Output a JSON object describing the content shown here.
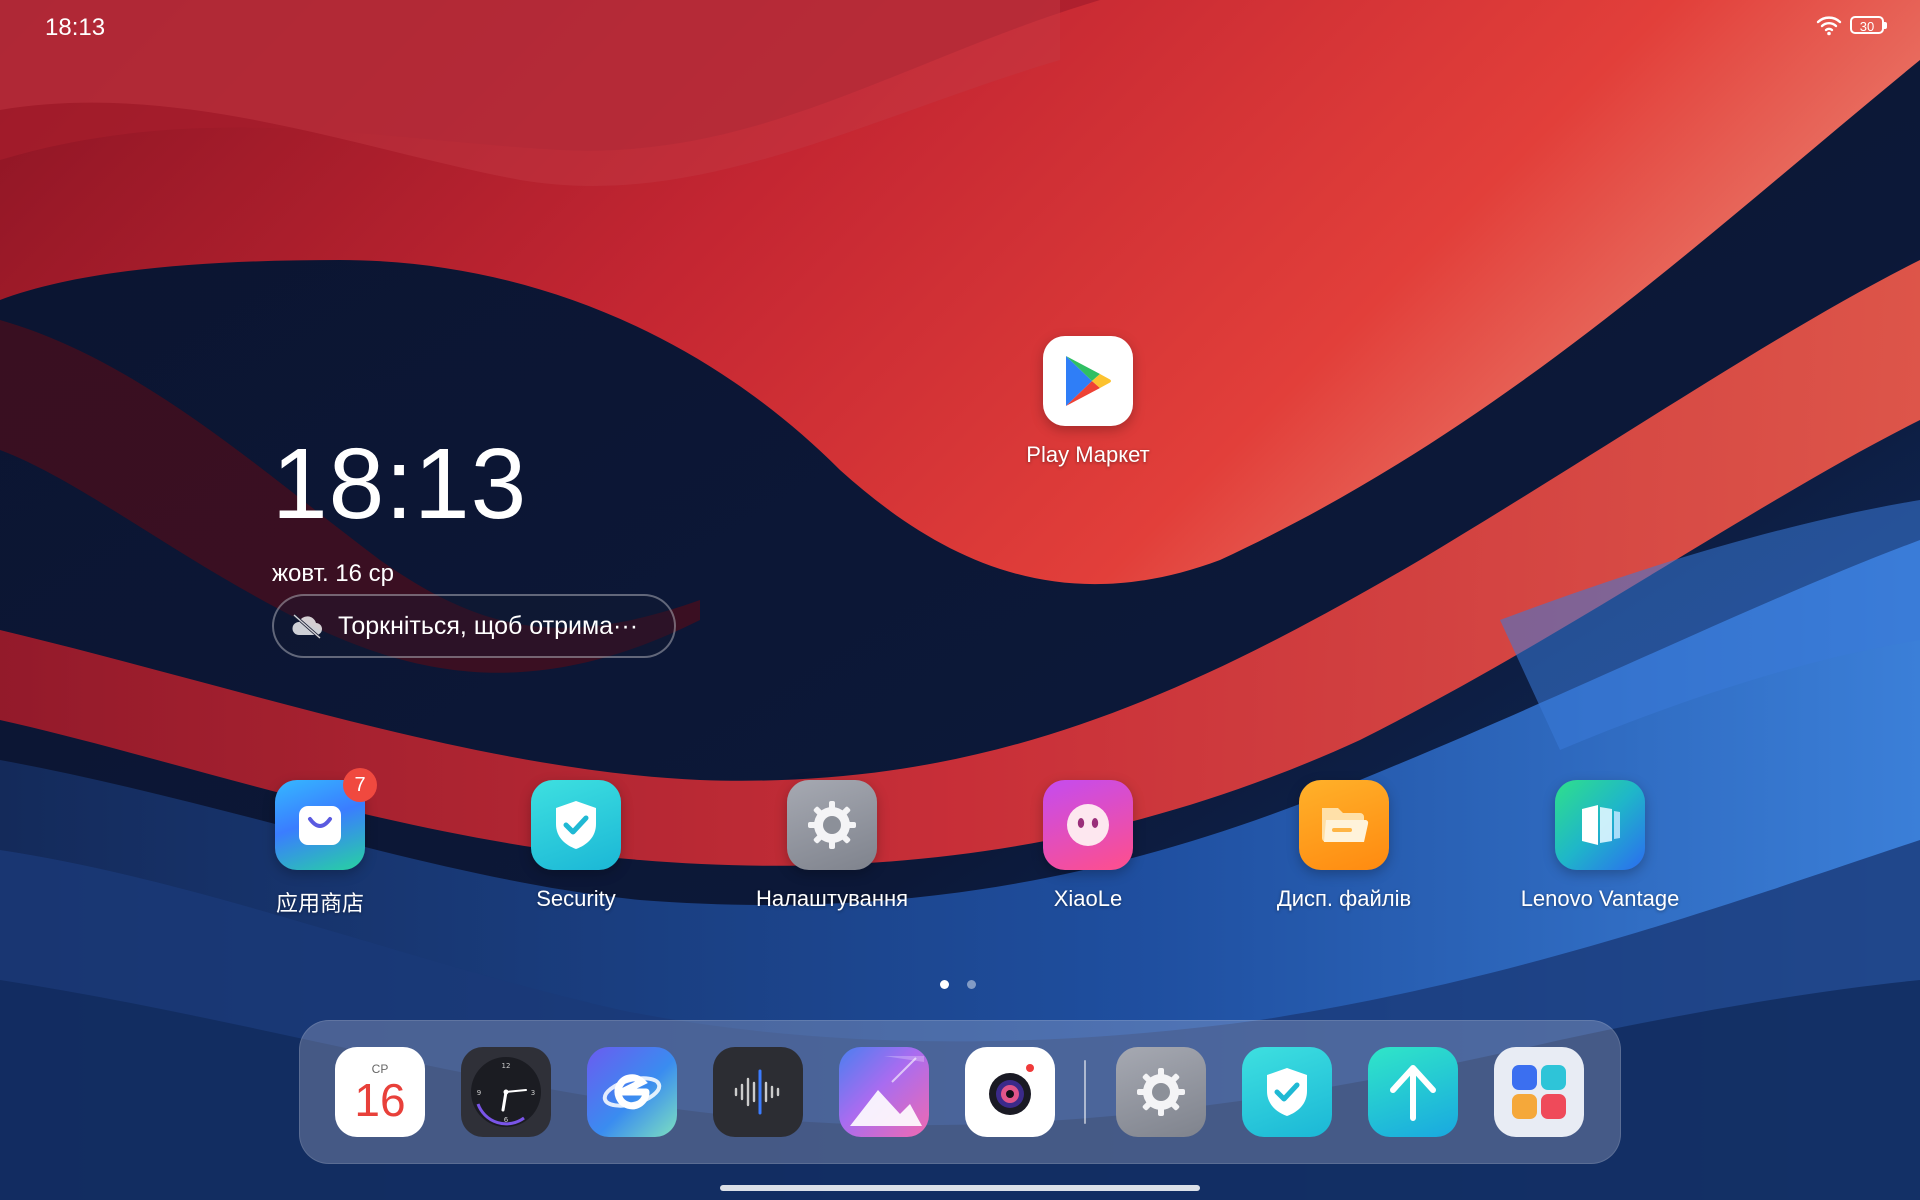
{
  "status_bar": {
    "time": "18:13",
    "battery_level": "30",
    "wifi_icon": "wifi-icon"
  },
  "clock_widget": {
    "time": "18:13",
    "date": "жовт. 16 ср"
  },
  "weather_widget": {
    "text": "Торкніться, щоб отрима···",
    "icon": "cloud-off-icon"
  },
  "apps": {
    "play_market": {
      "label": "Play Маркет",
      "icon": "google-play-icon"
    },
    "app_store": {
      "label": "应用商店",
      "icon": "shopping-bag-icon",
      "badge": "7"
    },
    "security": {
      "label": "Security",
      "icon": "shield-check-icon"
    },
    "settings": {
      "label": "Налаштування",
      "icon": "gear-icon"
    },
    "xiaole": {
      "label": "XiaoLe",
      "icon": "xiaole-face-icon"
    },
    "file_manager": {
      "label": "Дисп. файлів",
      "icon": "folder-icon"
    },
    "lenovo_vantage": {
      "label": "Lenovo Vantage",
      "icon": "vantage-icon"
    }
  },
  "pages": {
    "count": 2,
    "active": 1
  },
  "dock": {
    "calendar": {
      "weekday": "СР",
      "day": "16"
    },
    "items": [
      "calendar-icon",
      "clock-icon",
      "browser-icon",
      "voice-recorder-icon",
      "gallery-icon",
      "camera-icon",
      "gear-icon",
      "shield-check-icon",
      "update-arrow-icon",
      "app-drawer-icon"
    ]
  },
  "colors": {
    "accent_red": "#d8323c",
    "accent_blue": "#2a66c8",
    "badge": "#f0493f"
  }
}
